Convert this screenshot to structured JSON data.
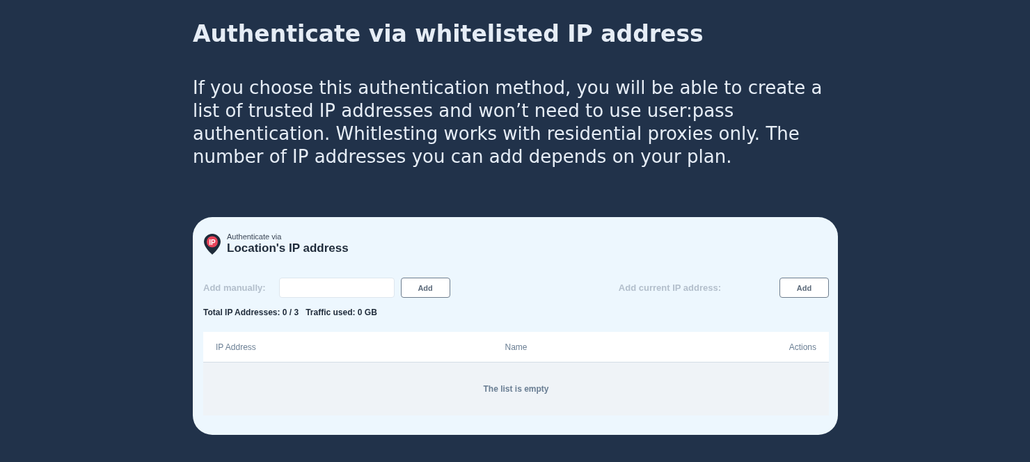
{
  "heading": "Authenticate via whitelisted IP address",
  "description": "If you choose this authentication method, you will be able to create a list of trusted IP addresses and won’t need to use user:pass authentication. Whitlesting works with residential proxies only. The number of IP addresses you can add depends on your plan.",
  "card": {
    "icon_label": "IP",
    "subtitle": "Authenticate via",
    "title": "Location's IP address",
    "manual": {
      "label": "Add manually:",
      "button": "Add"
    },
    "current": {
      "label": "Add current IP address:",
      "button": "Add"
    },
    "stats": "Total IP Addresses: 0 / 3   Traffic used: 0 GB",
    "table": {
      "columns": [
        "IP Address",
        "Name",
        "Actions"
      ],
      "empty_message": "The list is empty"
    }
  }
}
